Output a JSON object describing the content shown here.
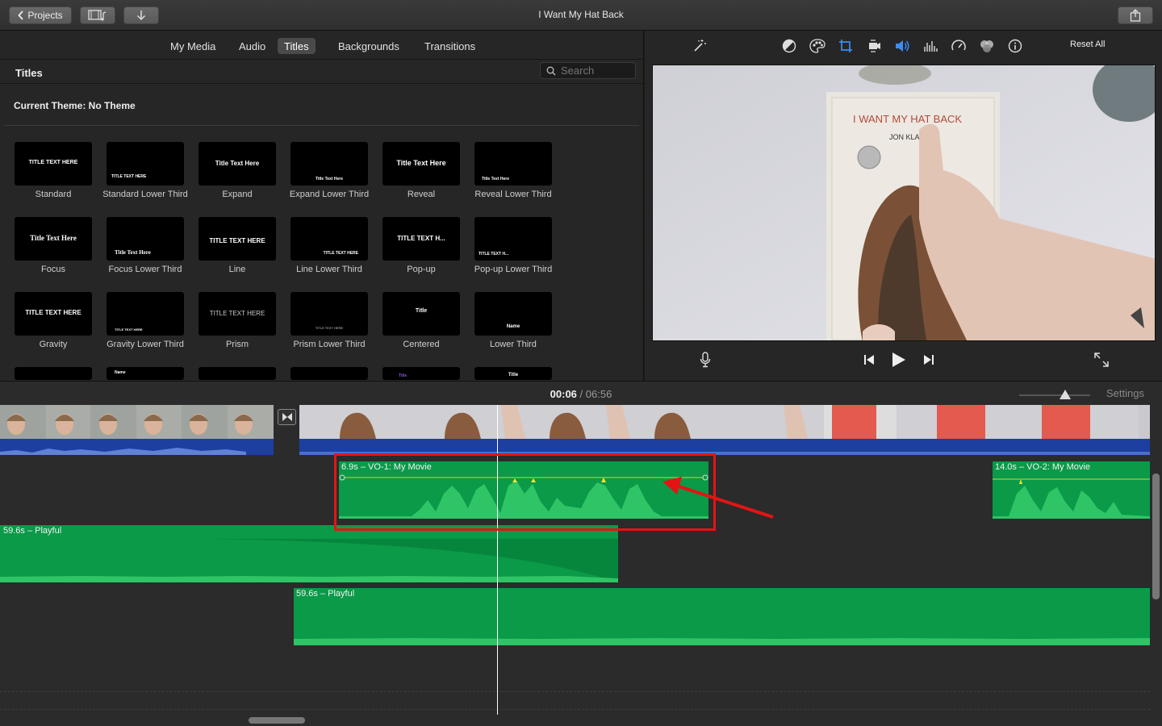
{
  "window": {
    "title": "I Want My Hat Back",
    "projects_label": "Projects"
  },
  "browser": {
    "tabs": [
      {
        "label": "My Media",
        "active": false
      },
      {
        "label": "Audio",
        "active": false
      },
      {
        "label": "Titles",
        "active": true
      },
      {
        "label": "Backgrounds",
        "active": false
      },
      {
        "label": "Transitions",
        "active": false
      }
    ],
    "section_title": "Titles",
    "search_placeholder": "Search",
    "current_theme": "Current Theme: No Theme",
    "titles": [
      {
        "label": "Standard",
        "thumb": "TITLE TEXT HERE"
      },
      {
        "label": "Standard Lower Third",
        "thumb": "TITLE TEXT HERE"
      },
      {
        "label": "Expand",
        "thumb": "Title Text Here"
      },
      {
        "label": "Expand Lower Third",
        "thumb": "Title Text Here"
      },
      {
        "label": "Reveal",
        "thumb": "Title Text Here"
      },
      {
        "label": "Reveal Lower Third",
        "thumb": "Title Text Here"
      },
      {
        "label": "Focus",
        "thumb": "Title Text Here"
      },
      {
        "label": "Focus Lower Third",
        "thumb": "Title Text Here"
      },
      {
        "label": "Line",
        "thumb": "TITLE TEXT HERE"
      },
      {
        "label": "Line Lower Third",
        "thumb": "TITLE TEXT HERE"
      },
      {
        "label": "Pop-up",
        "thumb": "TITLE TEXT H..."
      },
      {
        "label": "Pop-up Lower Third",
        "thumb": "TITLE TEXT H..."
      },
      {
        "label": "Gravity",
        "thumb": "TITLE TEXT HERE"
      },
      {
        "label": "Gravity Lower Third",
        "thumb": "TITLE TEXT HERE"
      },
      {
        "label": "Prism",
        "thumb": "TITLE TEXT HERE"
      },
      {
        "label": "Prism Lower Third",
        "thumb": "TITLE TEXT HERE"
      },
      {
        "label": "Centered",
        "thumb": "Title"
      },
      {
        "label": "Lower Third",
        "thumb": "Name"
      }
    ],
    "partial_row_thumbs": [
      "",
      "Name",
      "",
      "",
      "Title",
      "Title"
    ]
  },
  "viewer": {
    "reset_label": "Reset All",
    "tools": [
      "magic-wand-icon",
      "color-balance-icon",
      "color-correction-icon",
      "crop-icon",
      "stabilization-icon",
      "volume-icon",
      "noise-reduction-icon",
      "speed-icon",
      "video-overlay-icon",
      "info-icon"
    ],
    "book_title": "I WANT MY HAT BACK",
    "book_author": "JON KLA   N"
  },
  "timeline": {
    "current_time": "00:06",
    "separator": "/",
    "total_time": "06:56",
    "settings_label": "Settings",
    "clips": {
      "vo1": "6.9s – VO-1: My Movie",
      "vo2": "14.0s – VO-2: My Movie",
      "music1": "59.6s – Playful",
      "music2": "59.6s – Playful"
    }
  },
  "colors": {
    "audio_green": "#0a9a48",
    "video_audio_blue": "#1c3fa0",
    "highlight_red": "#e41414",
    "accent_blue": "#3b8df7"
  }
}
